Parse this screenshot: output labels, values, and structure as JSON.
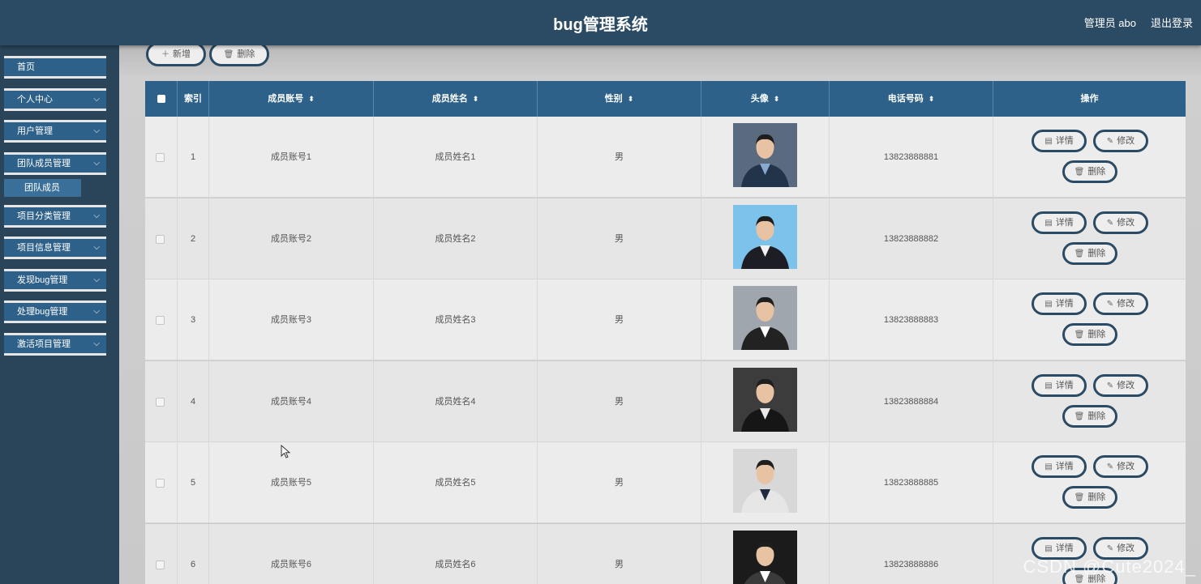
{
  "header": {
    "title": "bug管理系统",
    "user": "管理员 abo",
    "logout": "退出登录"
  },
  "sidebar": {
    "items": [
      {
        "label": "首页",
        "has_children": false
      },
      {
        "label": "个人中心",
        "has_children": true
      },
      {
        "label": "用户管理",
        "has_children": true
      },
      {
        "label": "团队成员管理",
        "has_children": true
      },
      {
        "label": "项目分类管理",
        "has_children": true
      },
      {
        "label": "项目信息管理",
        "has_children": true
      },
      {
        "label": "发现bug管理",
        "has_children": true
      },
      {
        "label": "处理bug管理",
        "has_children": true
      },
      {
        "label": "激活项目管理",
        "has_children": true
      }
    ],
    "active_sub": {
      "label": "团队成员"
    }
  },
  "toolbar": {
    "add_label": "新增",
    "delete_label": "删除"
  },
  "table": {
    "columns": [
      "索引",
      "成员账号",
      "成员姓名",
      "性别",
      "头像",
      "电话号码",
      "操作"
    ],
    "actions": {
      "detail": "详情",
      "edit": "修改",
      "delete": "删除"
    },
    "rows": [
      {
        "index": "1",
        "account": "成员账号1",
        "name": "成员姓名1",
        "gender": "男",
        "phone": "13823888881"
      },
      {
        "index": "2",
        "account": "成员账号2",
        "name": "成员姓名2",
        "gender": "男",
        "phone": "13823888882"
      },
      {
        "index": "3",
        "account": "成员账号3",
        "name": "成员姓名3",
        "gender": "男",
        "phone": "13823888883"
      },
      {
        "index": "4",
        "account": "成员账号4",
        "name": "成员姓名4",
        "gender": "男",
        "phone": "13823888884"
      },
      {
        "index": "5",
        "account": "成员账号5",
        "name": "成员姓名5",
        "gender": "男",
        "phone": "13823888885"
      },
      {
        "index": "6",
        "account": "成员账号6",
        "name": "成员姓名6",
        "gender": "男",
        "phone": "13823888886"
      }
    ]
  },
  "watermark": "CSDN @Cute2024_",
  "colors": {
    "header": "#2b4a63",
    "sidebar": "#2a4459",
    "table_head": "#2e6189",
    "button_border": "#2b4a63"
  }
}
